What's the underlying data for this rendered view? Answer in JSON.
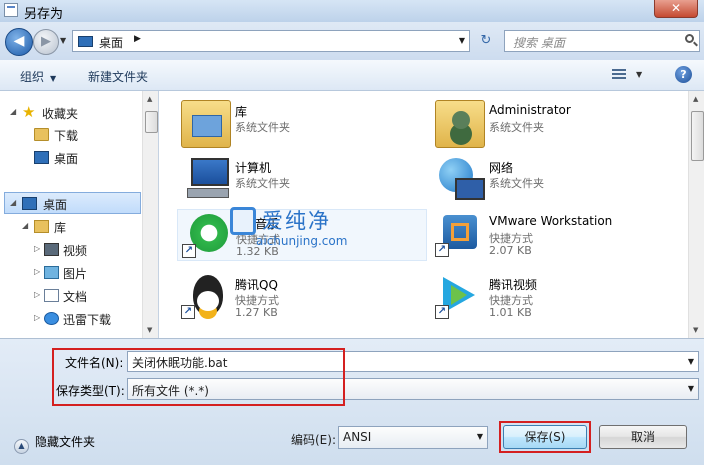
{
  "window": {
    "title": "另存为",
    "close_glyph": "✕"
  },
  "address": {
    "location": "桌面",
    "separator": "▶",
    "search_placeholder": "搜索 桌面"
  },
  "toolbar": {
    "organize": "组织",
    "new_folder": "新建文件夹",
    "help": "?"
  },
  "nav_tree": [
    {
      "label": "收藏夹",
      "icon": "star-icon",
      "expander": "◢"
    },
    {
      "label": "下载",
      "icon": "download-folder-icon"
    },
    {
      "label": "桌面",
      "icon": "desktop-icon"
    },
    {
      "label": "桌面",
      "icon": "desktop-icon",
      "expander": "◢",
      "selected": true
    },
    {
      "label": "库",
      "icon": "library-icon",
      "expander": "◢"
    },
    {
      "label": "视频",
      "icon": "video-library-icon",
      "expander": "▷"
    },
    {
      "label": "图片",
      "icon": "picture-library-icon",
      "expander": "▷"
    },
    {
      "label": "文档",
      "icon": "document-library-icon",
      "expander": "▷"
    },
    {
      "label": "迅雷下载",
      "icon": "thunder-download-icon",
      "expander": "▷"
    }
  ],
  "files": [
    {
      "name": "库",
      "line1": "系统文件夹",
      "line2": "",
      "icon": "library-folder-icon"
    },
    {
      "name": "Administrator",
      "line1": "系统文件夹",
      "line2": "",
      "icon": "user-folder-icon"
    },
    {
      "name": "计算机",
      "line1": "系统文件夹",
      "line2": "",
      "icon": "computer-icon"
    },
    {
      "name": "网络",
      "line1": "系统文件夹",
      "line2": "",
      "icon": "network-icon"
    },
    {
      "name": "QQ音乐",
      "line1": "快捷方式",
      "line2": "1.32 KB",
      "icon": "qq-music-icon"
    },
    {
      "name": "VMware Workstation",
      "line1": "快捷方式",
      "line2": "2.07 KB",
      "icon": "vmware-icon"
    },
    {
      "name": "腾讯QQ",
      "line1": "快捷方式",
      "line2": "1.27 KB",
      "icon": "qq-penguin-icon"
    },
    {
      "name": "腾讯视频",
      "line1": "快捷方式",
      "line2": "1.01 KB",
      "icon": "tencent-video-icon"
    }
  ],
  "watermark": {
    "cn": "爱纯净",
    "en": "aichunjing.com"
  },
  "form": {
    "filename_label": "文件名(N):",
    "filename_value": "关闭休眠功能.bat",
    "filetype_label": "保存类型(T):",
    "filetype_value": "所有文件  (*.*)",
    "hide_folders": "隐藏文件夹",
    "encoding_label": "编码(E):",
    "encoding_value": "ANSI",
    "save": "保存(S)",
    "cancel": "取消"
  },
  "colors": {
    "highlight_box": "#d42020",
    "accent": "#2f6fb8"
  }
}
